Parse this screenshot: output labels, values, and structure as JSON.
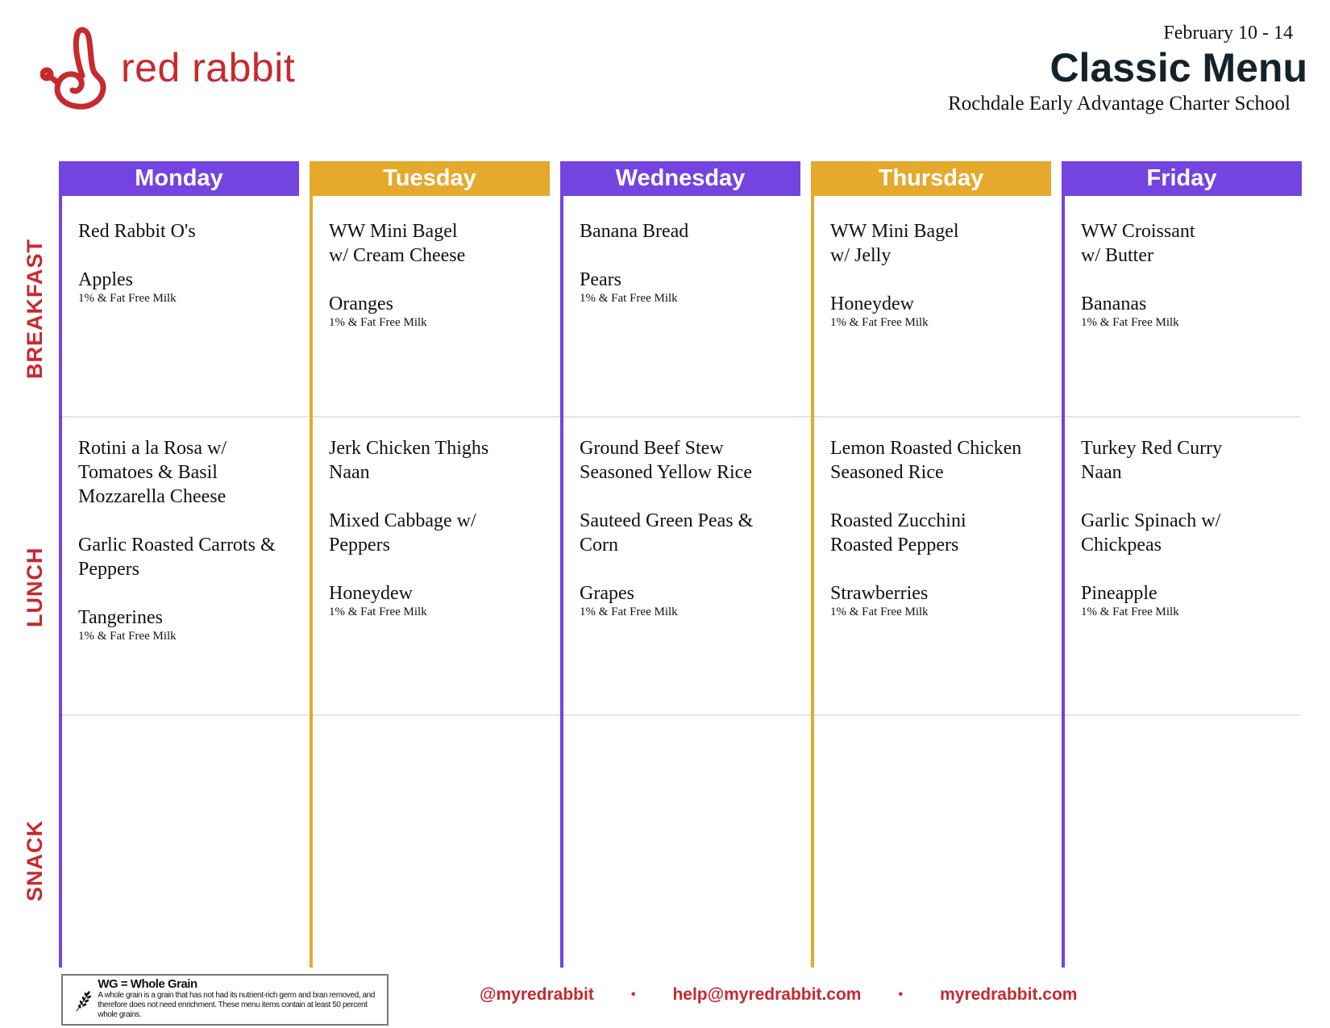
{
  "brand": {
    "name": "red rabbit",
    "logo_icon": "rabbit-swirl-icon",
    "color": "#c62a2f"
  },
  "header": {
    "week": "February 10 - 14",
    "title": "Classic Menu",
    "school": "Rochdale Early Advantage Charter School"
  },
  "colors": {
    "purple": "#7344e0",
    "gold": "#e5a92c",
    "red": "#c62a2f",
    "title": "#14222a"
  },
  "meals": [
    "BREAKFAST",
    "LUNCH",
    "SNACK"
  ],
  "days": [
    {
      "name": "Monday",
      "color": "purple",
      "breakfast": [
        {
          "main": "Red Rabbit O's"
        },
        {
          "main": "Apples",
          "sub": "1% & Fat Free Milk"
        }
      ],
      "lunch": [
        {
          "main": "Rotini a la Rosa w/\nTomatoes & Basil\nMozzarella Cheese"
        },
        {
          "main": "Garlic Roasted Carrots &\nPeppers"
        },
        {
          "main": "Tangerines",
          "sub": "1% & Fat Free Milk"
        }
      ],
      "snack": []
    },
    {
      "name": "Tuesday",
      "color": "gold",
      "breakfast": [
        {
          "main": "WW Mini Bagel\nw/ Cream Cheese"
        },
        {
          "main": "Oranges",
          "sub": "1% & Fat Free Milk"
        }
      ],
      "lunch": [
        {
          "main": "Jerk Chicken Thighs\nNaan"
        },
        {
          "main": "Mixed Cabbage w/\nPeppers"
        },
        {
          "main": "Honeydew",
          "sub": "1% & Fat Free Milk"
        }
      ],
      "snack": []
    },
    {
      "name": "Wednesday",
      "color": "purple",
      "breakfast": [
        {
          "main": "Banana Bread"
        },
        {
          "main": "Pears",
          "sub": "1% & Fat Free Milk"
        }
      ],
      "lunch": [
        {
          "main": "Ground Beef Stew\nSeasoned Yellow Rice"
        },
        {
          "main": "Sauteed Green Peas &\nCorn"
        },
        {
          "main": "Grapes",
          "sub": "1% & Fat Free Milk"
        }
      ],
      "snack": []
    },
    {
      "name": "Thursday",
      "color": "gold",
      "breakfast": [
        {
          "main": "WW Mini Bagel\nw/ Jelly"
        },
        {
          "main": "Honeydew",
          "sub": "1% & Fat Free Milk"
        }
      ],
      "lunch": [
        {
          "main": "Lemon Roasted Chicken\nSeasoned Rice"
        },
        {
          "main": "Roasted Zucchini\nRoasted Peppers"
        },
        {
          "main": "Strawberries",
          "sub": "1% & Fat Free Milk"
        }
      ],
      "snack": []
    },
    {
      "name": "Friday",
      "color": "purple",
      "breakfast": [
        {
          "main": "WW Croissant\nw/ Butter"
        },
        {
          "main": "Bananas",
          "sub": "1% & Fat Free Milk"
        }
      ],
      "lunch": [
        {
          "main": "Turkey Red Curry\nNaan"
        },
        {
          "main": "Garlic Spinach w/\nChickpeas"
        },
        {
          "main": "Pineapple",
          "sub": "1% & Fat Free Milk"
        }
      ],
      "snack": []
    }
  ],
  "legend": {
    "icon": "wheat-icon",
    "title": "WG = Whole Grain",
    "description": "A whole grain is a grain that has not had its nutrient-rich germ and bran removed, and therefore does not need enrichment. These menu items contain at least 50 percent whole grains."
  },
  "footer": {
    "social": "@myredrabbit",
    "email": "help@myredrabbit.com",
    "website": "myredrabbit.com",
    "separator": "•"
  }
}
